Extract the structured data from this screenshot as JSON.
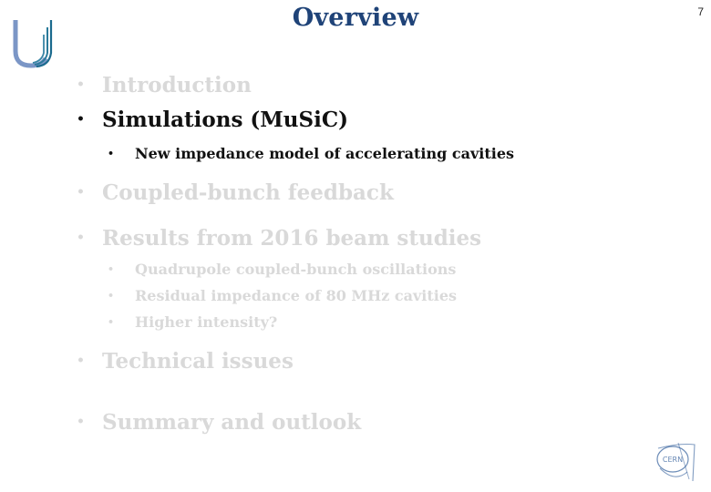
{
  "slide": {
    "title": "Overview",
    "page_number": "7",
    "colors": {
      "title": "#1f4378",
      "active": "#111111",
      "inactive": "#d9d9d9"
    },
    "items": [
      {
        "label": "Introduction",
        "state": "inactive"
      },
      {
        "label": "Simulations (MuSiC)",
        "state": "active",
        "sub": [
          {
            "label": "New impedance model of accelerating cavities",
            "state": "active"
          }
        ]
      },
      {
        "label": "Coupled-bunch feedback",
        "state": "inactive"
      },
      {
        "label": "Results from 2016 beam studies",
        "state": "inactive",
        "sub": [
          {
            "label": "Quadrupole coupled-bunch oscillations",
            "state": "inactive"
          },
          {
            "label": "Residual impedance of 80 MHz cavities",
            "state": "inactive"
          },
          {
            "label": "Higher intensity?",
            "state": "inactive"
          }
        ]
      },
      {
        "label": "Technical issues",
        "state": "inactive"
      },
      {
        "label": "Summary and outlook",
        "state": "inactive"
      }
    ],
    "bullet": "•",
    "logos": {
      "top_left": "university-u-logo",
      "bottom_right": "cern-logo",
      "cern_text": "CERN"
    }
  }
}
